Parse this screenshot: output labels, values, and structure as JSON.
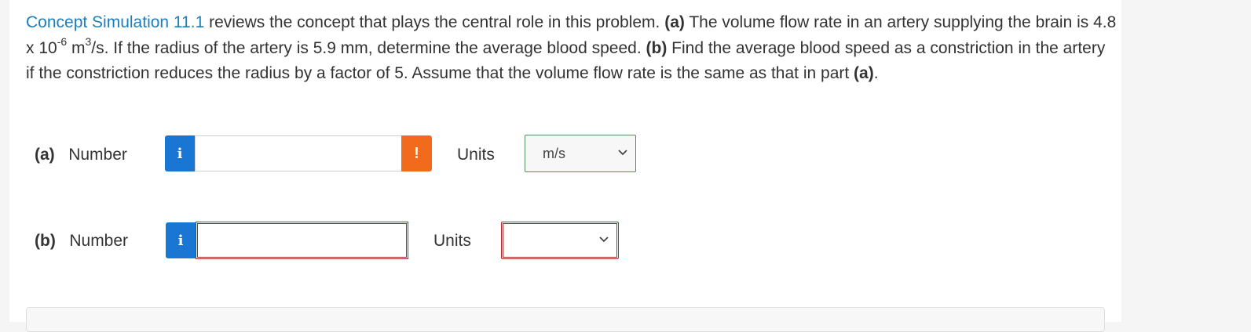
{
  "question": {
    "link_text": "Concept Simulation 11.1",
    "intro": " reviews the concept that plays the central role in this problem. ",
    "part_a_tag": "(a)",
    "part_a_text_1": " The volume flow rate in an artery supplying the brain is 4.8 x 10",
    "exponent_1": "-6",
    "part_a_text_2": " m",
    "exponent_2": "3",
    "part_a_text_3": "/s. If the radius of the artery is 5.9 mm, determine the average blood speed. ",
    "part_b_tag": "(b)",
    "part_b_text": " Find the average blood speed as a constriction in the artery if the constriction reduces the radius by a factor of 5. Assume that the volume flow rate is the same as that in part ",
    "part_ref_tag": "(a)",
    "end": "."
  },
  "rows": [
    {
      "part": "(a)",
      "label": "Number",
      "info_icon": "info-icon",
      "info_glyph": "i",
      "value": "",
      "warn_icon": "warning-icon",
      "warn_glyph": "!",
      "units_label": "Units",
      "unit_selected": "m/s"
    },
    {
      "part": "(b)",
      "label": "Number",
      "info_icon": "info-icon",
      "info_glyph": "i",
      "value": "",
      "units_label": "Units",
      "unit_selected": ""
    }
  ],
  "colors": {
    "link": "#1a7ec1",
    "info_button": "#1976d2",
    "warning_button": "#f26a1c",
    "error_border": "#b0282b",
    "valid_border": "#5a8a5a"
  }
}
